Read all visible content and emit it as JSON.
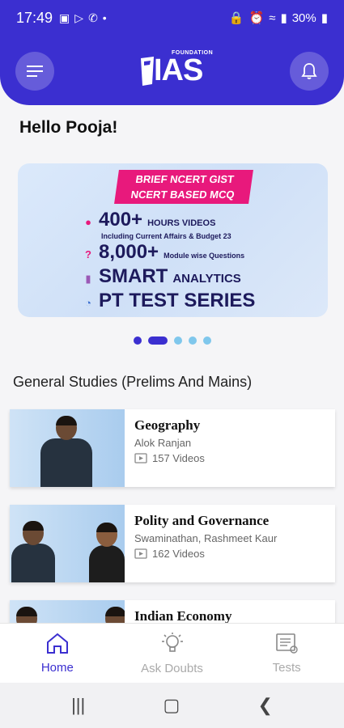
{
  "status_bar": {
    "time": "17:49",
    "battery": "30%",
    "left_icons": [
      "image-icon",
      "play-store-icon",
      "missed-call-icon",
      "dot-icon"
    ],
    "right_icons": [
      "lock-icon",
      "alarm-icon",
      "wifi-icon",
      "signal-icon",
      "battery-icon"
    ]
  },
  "header": {
    "logo_small": "FOUNDATION",
    "logo_big": "IAS",
    "menu_icon": "menu-icon",
    "bell_icon": "bell-icon",
    "bg_color": "#3b2fd0"
  },
  "greeting": "Hello Pooja!",
  "banner": {
    "tag_line1": "BRIEF NCERT GIST",
    "tag_line2": "NCERT BASED MCQ",
    "row1_big": "400+",
    "row1_small": "HOURS VIDEOS",
    "row1_sub": "Including Current Affairs & Budget 23",
    "row2_big": "8,000+",
    "row2_small": "Module wise Questions",
    "row3_big": "SMART",
    "row3_small": "ANALYTICS",
    "row4_big": "PT TEST SERIES",
    "carousel_count": 5,
    "carousel_current": 2
  },
  "section_title": "General Studies (Prelims And Mains)",
  "courses": [
    {
      "title": "Geography",
      "author": "Alok Ranjan",
      "videos": "157 Videos"
    },
    {
      "title": "Polity and Governance",
      "author": "Swaminathan, Rashmeet Kaur",
      "videos": "162 Videos"
    },
    {
      "title": "Indian Economy",
      "author": "",
      "videos": ""
    }
  ],
  "bottom_nav": [
    {
      "label": "Home",
      "icon": "home-icon",
      "active": true
    },
    {
      "label": "Ask Doubts",
      "icon": "lightbulb-icon",
      "active": false
    },
    {
      "label": "Tests",
      "icon": "test-paper-icon",
      "active": false
    }
  ],
  "colors": {
    "accent": "#3b2fd0",
    "banner_tag": "#e8197c"
  }
}
